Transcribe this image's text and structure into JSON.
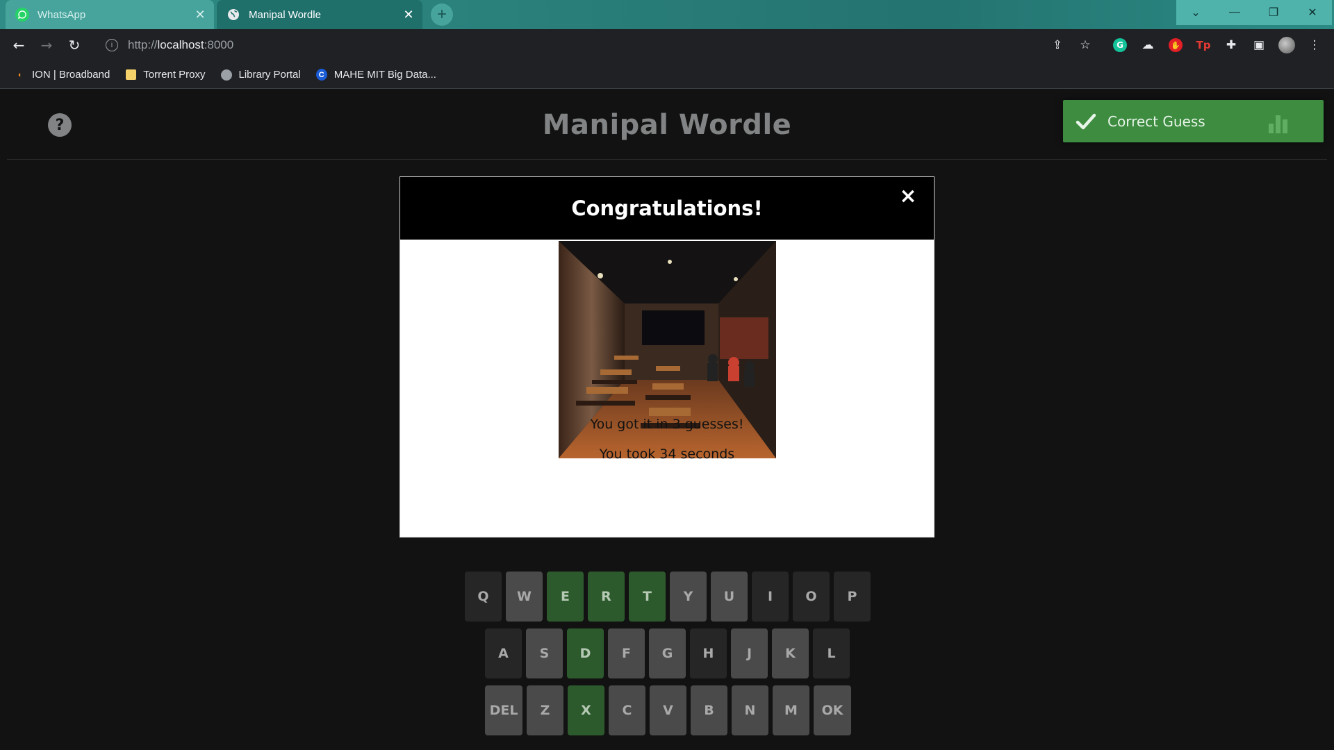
{
  "browser": {
    "tabs": [
      {
        "title": "WhatsApp",
        "icon": "whatsapp-icon",
        "active": false
      },
      {
        "title": "Manipal Wordle",
        "icon": "globe-icon",
        "active": true
      }
    ],
    "url_prefix": "http://",
    "url_host": "localhost",
    "url_suffix": ":8000",
    "bookmarks": [
      {
        "label": "ION | Broadband",
        "icon": "ion-icon"
      },
      {
        "label": "Torrent Proxy",
        "icon": "folder-icon"
      },
      {
        "label": "Library Portal",
        "icon": "globe-icon"
      },
      {
        "label": "MAHE MIT Big Data...",
        "icon": "c-logo-icon"
      }
    ]
  },
  "page": {
    "title": "Manipal Wordle",
    "help_glyph": "?",
    "toast": {
      "text": "Correct Guess",
      "color": "#3d8c40"
    }
  },
  "modal": {
    "title": "Congratulations!",
    "close_glyph": "×",
    "guesses_text": "You got it in 3 guesses!",
    "time_text": "You took 34 seconds"
  },
  "keyboard": {
    "colors": {
      "correct": "#2d5a2d",
      "unused": "#4a4a4a",
      "absent": "#262626"
    },
    "rows": [
      [
        {
          "k": "Q",
          "s": "absent"
        },
        {
          "k": "W",
          "s": "unused"
        },
        {
          "k": "E",
          "s": "correct"
        },
        {
          "k": "R",
          "s": "correct"
        },
        {
          "k": "T",
          "s": "correct"
        },
        {
          "k": "Y",
          "s": "unused"
        },
        {
          "k": "U",
          "s": "unused"
        },
        {
          "k": "I",
          "s": "absent"
        },
        {
          "k": "O",
          "s": "absent"
        },
        {
          "k": "P",
          "s": "absent"
        }
      ],
      [
        {
          "k": "A",
          "s": "absent"
        },
        {
          "k": "S",
          "s": "unused"
        },
        {
          "k": "D",
          "s": "correct"
        },
        {
          "k": "F",
          "s": "unused"
        },
        {
          "k": "G",
          "s": "unused"
        },
        {
          "k": "H",
          "s": "absent"
        },
        {
          "k": "J",
          "s": "unused"
        },
        {
          "k": "K",
          "s": "unused"
        },
        {
          "k": "L",
          "s": "absent"
        }
      ],
      [
        {
          "k": "DEL",
          "s": "unused"
        },
        {
          "k": "Z",
          "s": "unused"
        },
        {
          "k": "X",
          "s": "correct"
        },
        {
          "k": "C",
          "s": "unused"
        },
        {
          "k": "V",
          "s": "unused"
        },
        {
          "k": "B",
          "s": "unused"
        },
        {
          "k": "N",
          "s": "unused"
        },
        {
          "k": "M",
          "s": "unused"
        },
        {
          "k": "OK",
          "s": "unused"
        }
      ]
    ]
  }
}
